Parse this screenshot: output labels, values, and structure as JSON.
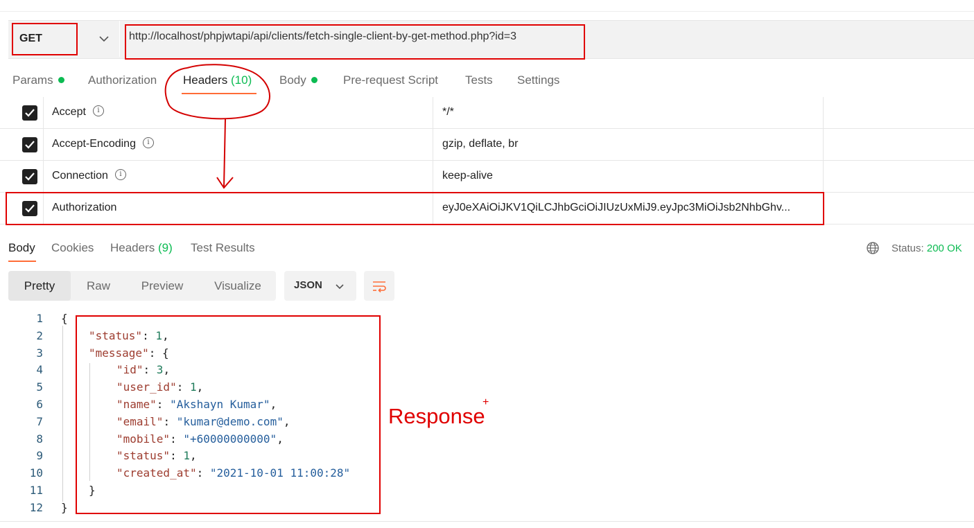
{
  "request": {
    "method": "GET",
    "url": "http://localhost/phpjwtapi/api/clients/fetch-single-client-by-get-method.php?id=3"
  },
  "request_tabs": [
    {
      "label": "Params",
      "dot": true
    },
    {
      "label": "Authorization"
    },
    {
      "label": "Headers",
      "count": "(10)",
      "active": true
    },
    {
      "label": "Body",
      "dot": true
    },
    {
      "label": "Pre-request Script"
    },
    {
      "label": "Tests"
    },
    {
      "label": "Settings"
    }
  ],
  "headers": [
    {
      "key": "Accept",
      "value": "*/*",
      "checked": true,
      "info": true
    },
    {
      "key": "Accept-Encoding",
      "value": "gzip, deflate, br",
      "checked": true,
      "info": true
    },
    {
      "key": "Connection",
      "value": "keep-alive",
      "checked": true,
      "info": true
    },
    {
      "key": "Authorization",
      "value": "eyJ0eXAiOiJKV1QiLCJhbGciOiJIUzUxMiJ9.eyJpc3MiOiJsb2NhbGhv...",
      "checked": true,
      "info": false
    }
  ],
  "response_tabs": [
    {
      "label": "Body",
      "active": true
    },
    {
      "label": "Cookies"
    },
    {
      "label": "Headers",
      "count": "(9)"
    },
    {
      "label": "Test Results"
    }
  ],
  "status": {
    "label": "Status:",
    "value": "200 OK"
  },
  "view_modes": [
    "Pretty",
    "Raw",
    "Preview",
    "Visualize"
  ],
  "active_view": "Pretty",
  "format": "JSON",
  "code_lines": [
    "{",
    "\"status\": 1,",
    "\"message\": {",
    "\"id\": 3,",
    "\"user_id\": 1,",
    "\"name\": \"Akshayn Kumar\",",
    "\"email\": \"kumar@demo.com\",",
    "\"mobile\": \"+60000000000\",",
    "\"status\": 1,",
    "\"created_at\": \"2021-10-01 11:00:28\"",
    "}",
    "}"
  ],
  "annotation": {
    "label": "Response",
    "plus": "+"
  },
  "colors": {
    "accent": "#ff6c37",
    "success": "#0cbb52",
    "annotation": "#e00000"
  },
  "icons": [
    "chevron-down-icon",
    "info-icon",
    "checkbox-icon",
    "globe-icon",
    "wrap-lines-icon"
  ]
}
